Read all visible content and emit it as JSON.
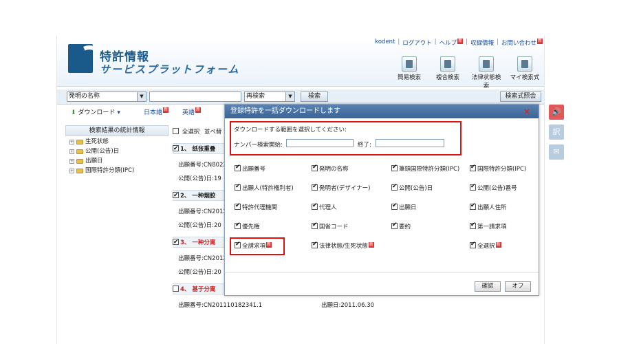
{
  "header": {
    "title": "特許情報",
    "subtitle": "サービスプラットフォーム",
    "links": [
      {
        "label": "kodent",
        "badge": ""
      },
      {
        "label": "ログアウト",
        "badge": ""
      },
      {
        "label": "ヘルプ",
        "badge": "新"
      },
      {
        "label": "収録情報",
        "badge": ""
      },
      {
        "label": "お問い合わせ",
        "badge": "新"
      }
    ],
    "tools": [
      "簡易検索",
      "複合検索",
      "法律状態検索",
      "マイ検索式"
    ]
  },
  "search": {
    "field_select": "発明の名称",
    "query_value": "",
    "mode_select": "再検索",
    "search_button": "検索",
    "formula_button": "検索式照会"
  },
  "toolbar": {
    "download_label": "ダウンロード",
    "lang_ja": "日本語",
    "lang_en": "英語",
    "badge": "新"
  },
  "stats": {
    "header": "検索結果の統計情報",
    "items": [
      "生死状態",
      "公開(公告)日",
      "出願日",
      "国際特許分類(IPC)"
    ]
  },
  "results": {
    "select_all": "全選択",
    "sort_label": "並べ替",
    "rows": [
      {
        "title": "1、 纸张重叠",
        "app_no": "出願番号:CN8022",
        "pub_date": "公開(公告)日:19"
      },
      {
        "title": "2、 一种烟胶",
        "app_no": "出願番号:CN2012",
        "pub_date": "公開(公告)日:20"
      },
      {
        "title": "3、 一种分离",
        "app_no": "出願番号:CN2012",
        "pub_date": "公開(公告)日:20"
      },
      {
        "title": "4、 基于分离",
        "app_no": "出願番号:CN201110182341.1",
        "app_date": "出願日:2011.06.30"
      }
    ]
  },
  "modal": {
    "title": "登録特許を一括ダウンロードします",
    "close_label": "×",
    "range_prompt": "ダウンロードする範囲を選択してください:",
    "range_start_label": "ナンバー検索開始:",
    "range_end_label": "終了:",
    "range_start_value": "",
    "range_end_value": "",
    "fields": [
      {
        "label": "出願番号",
        "checked": true,
        "badge": ""
      },
      {
        "label": "発明の名称",
        "checked": true,
        "badge": ""
      },
      {
        "label": "筆頭国際特許分類(IPC)",
        "checked": true,
        "badge": ""
      },
      {
        "label": "国際特許分類(IPC)",
        "checked": true,
        "badge": ""
      },
      {
        "label": "出願人(特許権利者)",
        "checked": true,
        "badge": ""
      },
      {
        "label": "発明者(デザイナー)",
        "checked": true,
        "badge": ""
      },
      {
        "label": "公開(公告)日",
        "checked": true,
        "badge": ""
      },
      {
        "label": "公開(公告)番号",
        "checked": true,
        "badge": ""
      },
      {
        "label": "特許代理機関",
        "checked": true,
        "badge": ""
      },
      {
        "label": "代理人",
        "checked": true,
        "badge": ""
      },
      {
        "label": "出願日",
        "checked": true,
        "badge": ""
      },
      {
        "label": "出願人住所",
        "checked": true,
        "badge": ""
      },
      {
        "label": "優先権",
        "checked": true,
        "badge": ""
      },
      {
        "label": "国省コード",
        "checked": true,
        "badge": ""
      },
      {
        "label": "要約",
        "checked": true,
        "badge": ""
      },
      {
        "label": "第一請求項",
        "checked": true,
        "badge": ""
      },
      {
        "label": "全請求項",
        "checked": true,
        "badge": "新"
      },
      {
        "label": "法律状態/生死状態",
        "checked": true,
        "badge": "新"
      },
      {
        "label": "",
        "checked": false,
        "badge": ""
      },
      {
        "label": "全選択",
        "checked": true,
        "badge": "新"
      }
    ],
    "confirm_button": "確認",
    "off_button": "オフ"
  },
  "side": {
    "icons": [
      "speaker-icon",
      "translate-icon",
      "mail-icon"
    ],
    "translate_glyph": "訳"
  }
}
